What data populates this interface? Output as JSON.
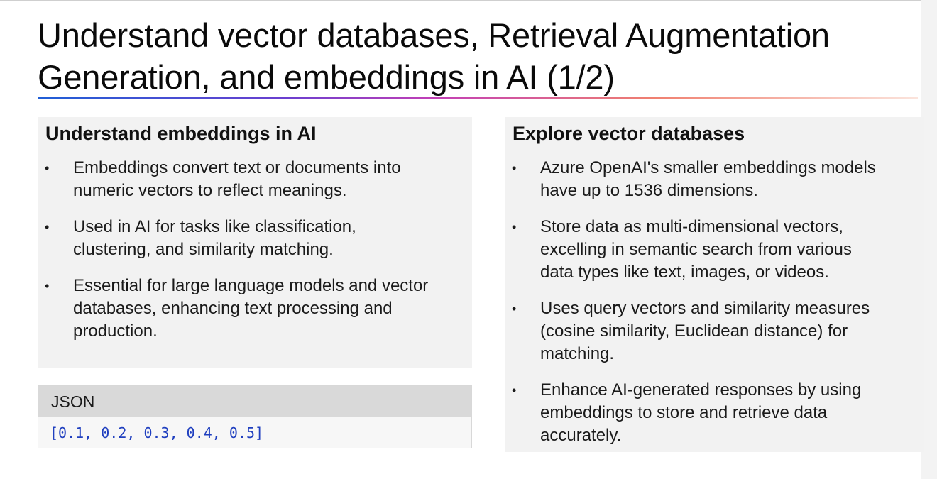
{
  "slide": {
    "title_line1": "Understand vector databases, Retrieval Augmentation",
    "title_line2": "Generation, and embeddings in AI (1/2)"
  },
  "left_panel": {
    "heading": "Understand embeddings in AI",
    "bullets": [
      {
        "line1": "Embeddings convert text or documents into",
        "line2": "numeric vectors to reflect meanings.",
        "line3": ""
      },
      {
        "line1": "Used in AI for tasks like classification,",
        "line2": "clustering, and similarity matching.",
        "line3": ""
      },
      {
        "line1": "Essential for large language models and vector",
        "line2": "databases, enhancing text processing and",
        "line3": "production."
      }
    ]
  },
  "code_block": {
    "language": "JSON",
    "code": "[0.1, 0.2, 0.3, 0.4, 0.5]"
  },
  "right_panel": {
    "heading": "Explore vector databases",
    "bullets": [
      {
        "line1": "Azure OpenAI's smaller embeddings models",
        "line2": "have up to 1536 dimensions.",
        "line3": ""
      },
      {
        "line1": "Store data as multi-dimensional vectors,",
        "line2": "excelling in semantic search from various",
        "line3": "data types like text, images, or videos."
      },
      {
        "line1": "Uses query vectors and similarity measures",
        "line2": "(cosine similarity, Euclidean distance) for",
        "line3": "matching."
      },
      {
        "line1": "Enhance AI-generated responses by using",
        "line2": "embeddings to store and retrieve data",
        "line3": "accurately."
      }
    ]
  },
  "bullet_glyph": "•",
  "colors": {
    "panel_bg": "#f2f2f2",
    "code_text": "#1f3fbf",
    "underline_start": "#1f5fd6",
    "underline_mid": "#c23fb6",
    "underline_end": "#f08070"
  }
}
